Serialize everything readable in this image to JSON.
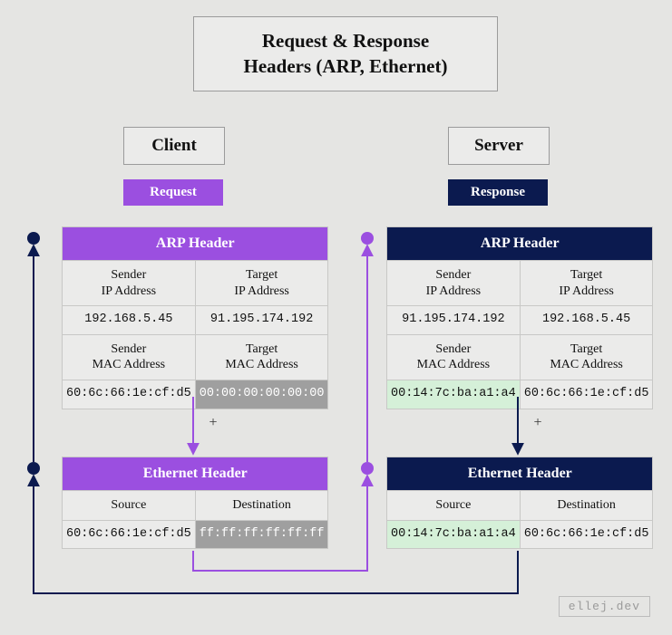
{
  "title_line1": "Request & Response",
  "title_line2": "Headers (ARP, Ethernet)",
  "roles": {
    "client": "Client",
    "server": "Server"
  },
  "badges": {
    "request": "Request",
    "response": "Response"
  },
  "plus": "+",
  "credit": "ellej.dev",
  "request": {
    "arp": {
      "header": "ARP Header",
      "sender_ip_label": "Sender\nIP Address",
      "target_ip_label": "Target\nIP Address",
      "sender_ip": "192.168.5.45",
      "target_ip": "91.195.174.192",
      "sender_mac_label": "Sender\nMAC Address",
      "target_mac_label": "Target\nMAC Address",
      "sender_mac": "60:6c:66:1e:cf:d5",
      "target_mac": "00:00:00:00:00:00"
    },
    "eth": {
      "header": "Ethernet Header",
      "source_label": "Source",
      "destination_label": "Destination",
      "source": "60:6c:66:1e:cf:d5",
      "destination": "ff:ff:ff:ff:ff:ff"
    }
  },
  "response": {
    "arp": {
      "header": "ARP Header",
      "sender_ip_label": "Sender\nIP Address",
      "target_ip_label": "Target\nIP Address",
      "sender_ip": "91.195.174.192",
      "target_ip": "192.168.5.45",
      "sender_mac_label": "Sender\nMAC Address",
      "target_mac_label": "Target\nMAC Address",
      "sender_mac": "00:14:7c:ba:a1:a4",
      "target_mac": "60:6c:66:1e:cf:d5"
    },
    "eth": {
      "header": "Ethernet Header",
      "source_label": "Source",
      "destination_label": "Destination",
      "source": "00:14:7c:ba:a1:a4",
      "destination": "60:6c:66:1e:cf:d5"
    }
  }
}
